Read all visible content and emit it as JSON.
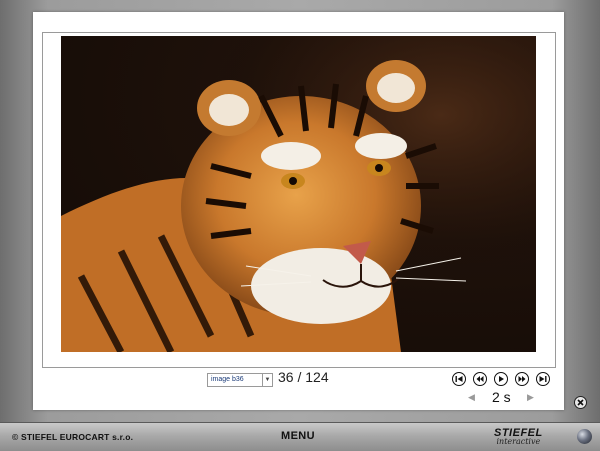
{
  "image_select": {
    "value": "image b36"
  },
  "counter": {
    "text": "36 / 124"
  },
  "slideshow": {
    "interval": "2 s"
  },
  "controls": [
    {
      "name": "first-icon"
    },
    {
      "name": "rewind-icon"
    },
    {
      "name": "play-icon"
    },
    {
      "name": "fast-forward-icon"
    },
    {
      "name": "last-icon"
    }
  ],
  "footer": {
    "copyright": "© STIEFEL EUROCART s.r.o.",
    "menu_label": "MENU",
    "brand_name": "STIEFEL",
    "brand_sub": "interactive"
  },
  "photo": {
    "subject": "tiger-photo"
  }
}
